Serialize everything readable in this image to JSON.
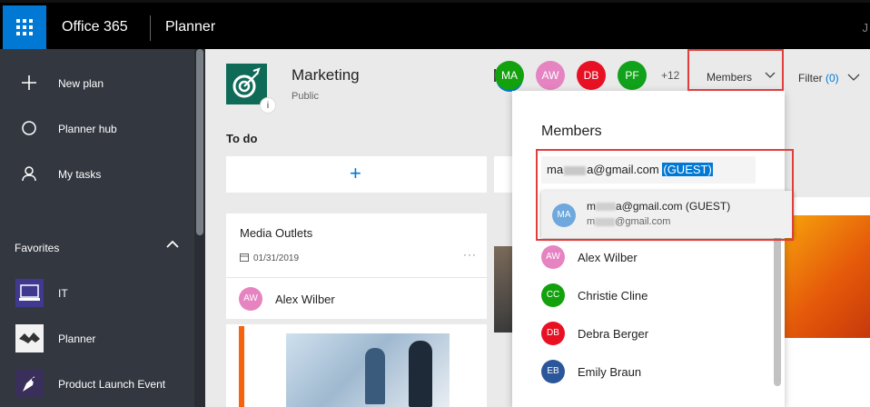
{
  "topbar": {
    "suite": "Office 365",
    "app": "Planner",
    "edge_char": "J"
  },
  "sidebar": {
    "nav": [
      {
        "label": "New plan",
        "icon": "plus-icon"
      },
      {
        "label": "Planner hub",
        "icon": "circle-icon"
      },
      {
        "label": "My tasks",
        "icon": "person-icon"
      }
    ],
    "favorites_heading": "Favorites",
    "favorites": [
      {
        "label": "IT"
      },
      {
        "label": "Planner"
      },
      {
        "label": "Product Launch Event"
      }
    ]
  },
  "plan": {
    "title": "Marketing",
    "visibility": "Public",
    "info": "i"
  },
  "header_members": {
    "avatars": [
      {
        "initials": "MA",
        "color": "#13a10e"
      },
      {
        "initials": "AW",
        "color": "#e684c2"
      },
      {
        "initials": "DB",
        "color": "#e81123"
      },
      {
        "initials": "PF",
        "color": "#11a11a"
      }
    ],
    "more": "+12",
    "members_label": "Members",
    "filter_label": "Filter",
    "filter_count": "(0)"
  },
  "board": {
    "bucket": "To do",
    "add": "+",
    "card1": {
      "title": "Media Outlets",
      "date": "01/31/2019",
      "more": "···",
      "assignee_initials": "AW",
      "assignee": "Alex Wilber"
    }
  },
  "members_panel": {
    "title": "Members",
    "search_prefix": "ma",
    "search_suffix": "a@gmail.com",
    "search_tag": "(GUEST)",
    "suggestion": {
      "initials": "MA",
      "main_prefix": "m",
      "main_suffix": "a@gmail.com (GUEST)",
      "sub_prefix": "m",
      "sub_suffix": "@gmail.com"
    },
    "members": [
      {
        "initials": "AW",
        "name": "Alex Wilber",
        "color": "#e684c2"
      },
      {
        "initials": "CC",
        "name": "Christie Cline",
        "color": "#13a10e"
      },
      {
        "initials": "DB",
        "name": "Debra Berger",
        "color": "#e81123"
      },
      {
        "initials": "EB",
        "name": "Emily Braun",
        "color": "#2b579a"
      }
    ]
  },
  "colors": {
    "accent": "#0078d4",
    "highlight_border": "#e23d3d"
  }
}
